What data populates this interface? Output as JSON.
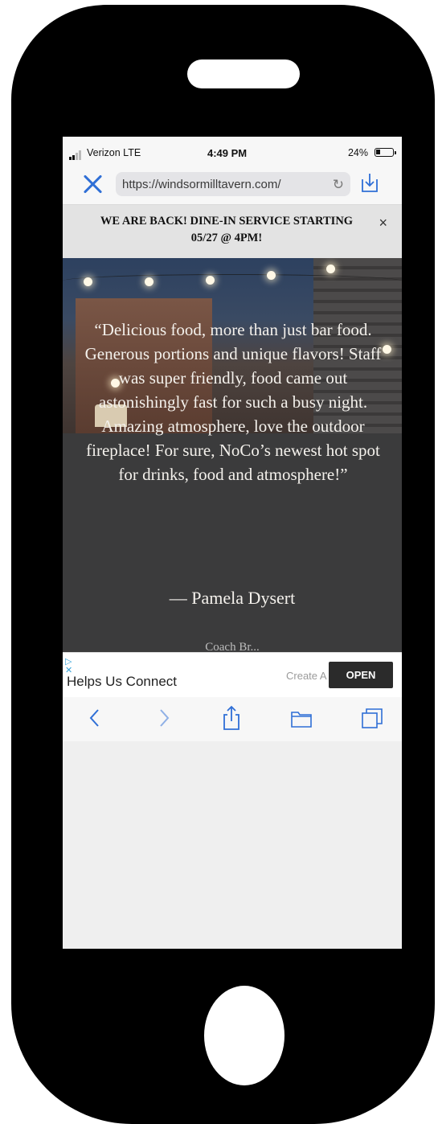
{
  "status_bar": {
    "carrier": "Verizon  LTE",
    "time": "4:49 PM",
    "battery": "24%"
  },
  "browser": {
    "url": "https://windsormilltavern.com/"
  },
  "banner": {
    "text": "WE ARE BACK! DINE-IN SERVICE STARTING 05/27 @ 4PM!",
    "close": "×"
  },
  "hero": {
    "quote": "“Delicious food, more than just bar food. Generous portions and unique flavors! Staff was super friendly, food came out astonishingly fast for such a busy night. Amazing atmosphere, love the outdoor fireplace! For sure, NoCo’s newest hot spot for drinks, food and atmosphere!”",
    "attribution": "— Pamela Dysert",
    "next_partial": "Coach Br..."
  },
  "ad": {
    "text": "Helps Us Connect",
    "create_partial": "Create A",
    "open_label": "OPEN"
  },
  "toolbar": {
    "icons": [
      "back-icon",
      "forward-icon",
      "share-icon",
      "bookmarks-icon",
      "tabs-icon"
    ]
  },
  "colors": {
    "accent_blue": "#2f6fd6",
    "hero_bg": "#3b3b3c",
    "banner_bg": "#e3e3e3"
  }
}
